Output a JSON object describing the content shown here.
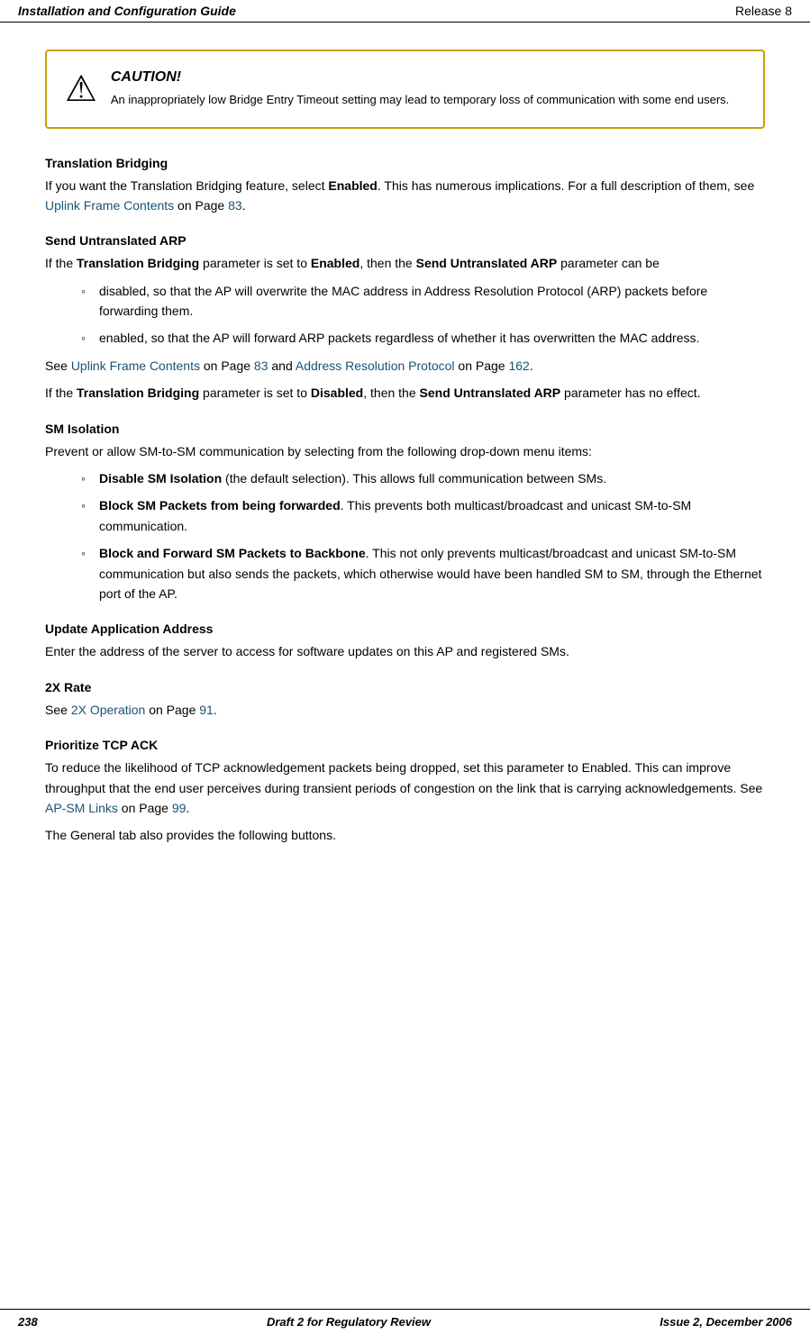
{
  "header": {
    "title": "Installation and Configuration Guide",
    "release": "Release 8"
  },
  "footer": {
    "page": "238",
    "draft": "Draft 2 for Regulatory Review",
    "issue": "Issue 2, December 2006"
  },
  "caution": {
    "title": "CAUTION!",
    "text": "An inappropriately low Bridge Entry Timeout setting may lead to temporary loss of communication with some end users."
  },
  "sections": [
    {
      "id": "translation-bridging",
      "heading": "Translation Bridging",
      "paragraphs": [
        "If you want the Translation Bridging feature, select <strong>Enabled</strong>. This has numerous implications. For a full description of them, see <a class=\"link\">Uplink Frame Contents</a> on Page <a class=\"link\">83</a>."
      ]
    },
    {
      "id": "send-untranslated-arp",
      "heading": "Send Untranslated ARP",
      "paragraphs": [
        "If the <strong>Translation Bridging</strong> parameter is set to <strong>Enabled</strong>, then the <strong>Send Untranslated ARP</strong> parameter can be"
      ],
      "bullets": [
        "disabled, so that the AP will overwrite the MAC address in Address Resolution Protocol (ARP) packets before forwarding them.",
        "enabled, so that the AP will forward ARP packets regardless of whether it has overwritten the MAC address."
      ],
      "after_bullets": [
        "See <a class=\"link\">Uplink Frame Contents</a> on Page <a class=\"link\">83</a> and <a class=\"link\">Address Resolution Protocol</a> on Page <a class=\"link\">162</a>.",
        "If the <strong>Translation Bridging</strong> parameter is set to <strong>Disabled</strong>, then the <strong>Send Untranslated ARP</strong> parameter has no effect."
      ]
    },
    {
      "id": "sm-isolation",
      "heading": "SM Isolation",
      "paragraphs": [
        "Prevent or allow SM-to-SM communication by selecting from the following drop-down menu items:"
      ],
      "bullets": [
        "<strong>Disable SM Isolation</strong> (the default selection). This allows full communication between SMs.",
        "<strong>Block SM Packets from being forwarded</strong>. This prevents both multicast/broadcast and unicast SM-to-SM communication.",
        "<strong>Block and Forward SM Packets to Backbone</strong>. This not only prevents multicast/broadcast and unicast SM-to-SM communication but also sends the packets, which otherwise would have been handled SM to SM, through the Ethernet port of the AP."
      ]
    },
    {
      "id": "update-application-address",
      "heading": "Update Application Address",
      "paragraphs": [
        "Enter the address of the server to access for software updates on this AP and registered SMs."
      ]
    },
    {
      "id": "2x-rate",
      "heading": "2X Rate",
      "paragraphs": [
        "See <a class=\"link\">2X Operation</a> on Page <a class=\"link\">91</a>."
      ]
    },
    {
      "id": "prioritize-tcp-ack",
      "heading": "Prioritize TCP ACK",
      "paragraphs": [
        "To reduce the likelihood of TCP acknowledgement packets being dropped, set this parameter to Enabled. This can improve throughput that the end user perceives during transient periods of congestion on the link that is carrying acknowledgements. See <a class=\"link\">AP-SM Links</a> on Page <a class=\"link\">99</a>.",
        "The General tab also provides the following buttons."
      ]
    }
  ],
  "links": {
    "uplink_frame_contents": "Uplink Frame Contents",
    "page_83": "83",
    "address_resolution_protocol": "Address Resolution Protocol",
    "page_162": "162",
    "operation_2x": "2X Operation",
    "page_91": "91",
    "ap_sm_links": "AP-SM Links",
    "page_99": "99"
  }
}
